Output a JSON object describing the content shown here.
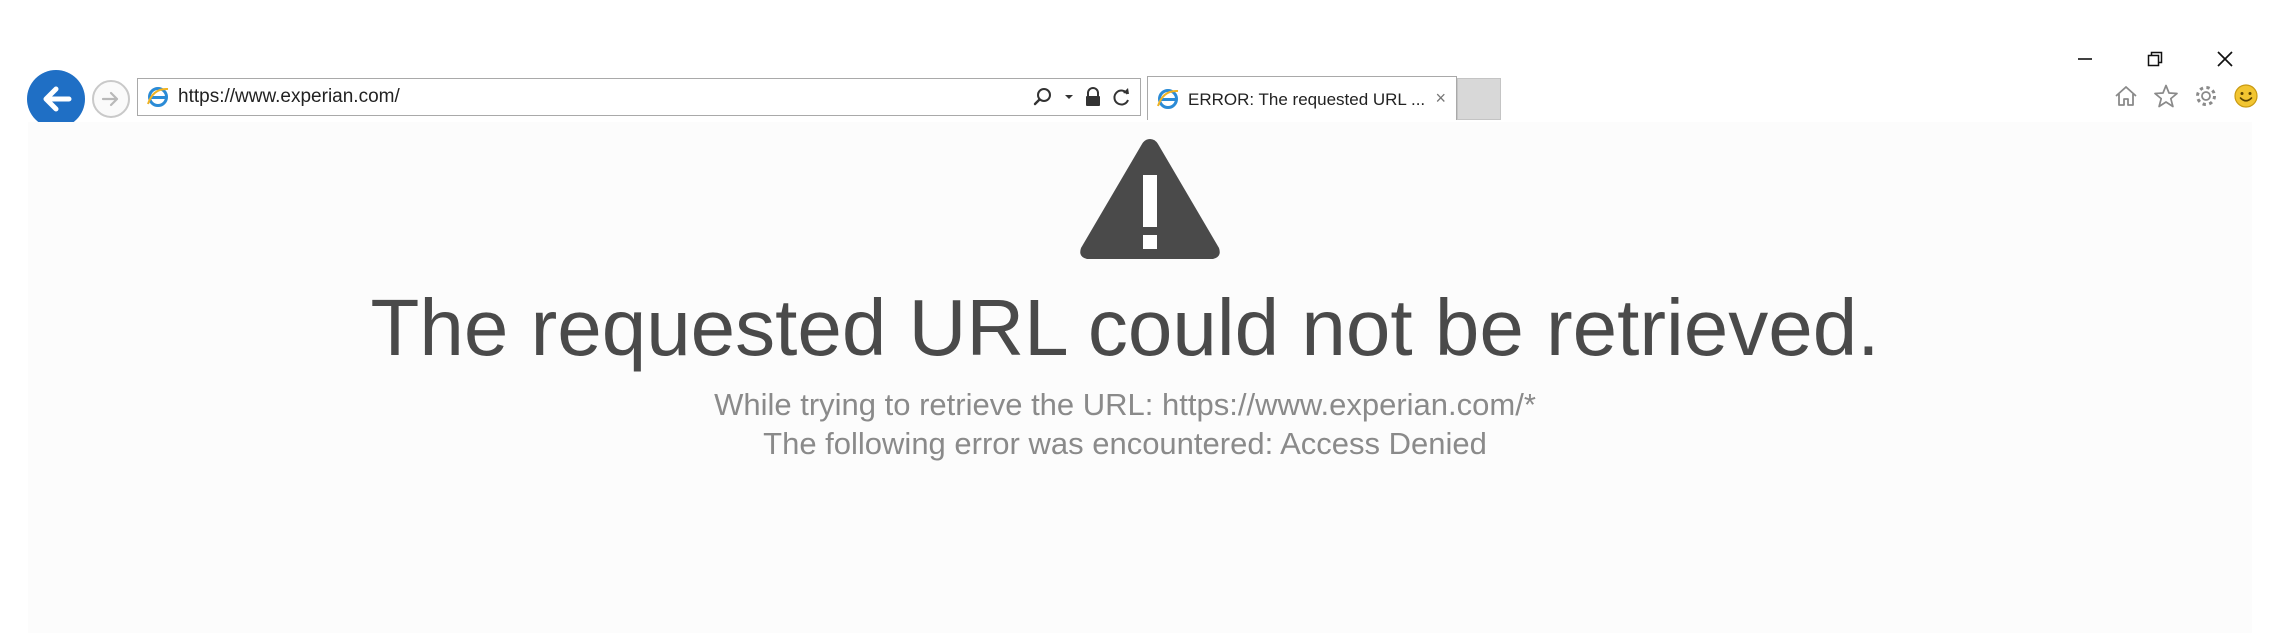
{
  "browser": {
    "address_bar": {
      "url": "https://www.experian.com/"
    },
    "tab": {
      "title": "ERROR: The requested URL ...",
      "close_glyph": "×"
    },
    "icons": {
      "back": "back-arrow-icon",
      "forward": "forward-arrow-icon",
      "site": "internet-explorer-icon",
      "search": "search-icon",
      "dropdown": "dropdown-arrow-icon",
      "lock": "lock-icon",
      "refresh": "refresh-icon",
      "home": "home-icon",
      "favorites": "star-icon",
      "tools": "gear-icon",
      "feedback": "smiley-icon"
    },
    "colors": {
      "back_button": "#1f6fc5",
      "feedback_smiley": "#f2c531",
      "warning_icon": "#4a4a4a"
    }
  },
  "error_page": {
    "title": "The requested URL could not be retrieved.",
    "url_line": "While trying to retrieve the URL: https://www.experian.com/*",
    "error_line": "The following error was encountered: Access Denied"
  }
}
